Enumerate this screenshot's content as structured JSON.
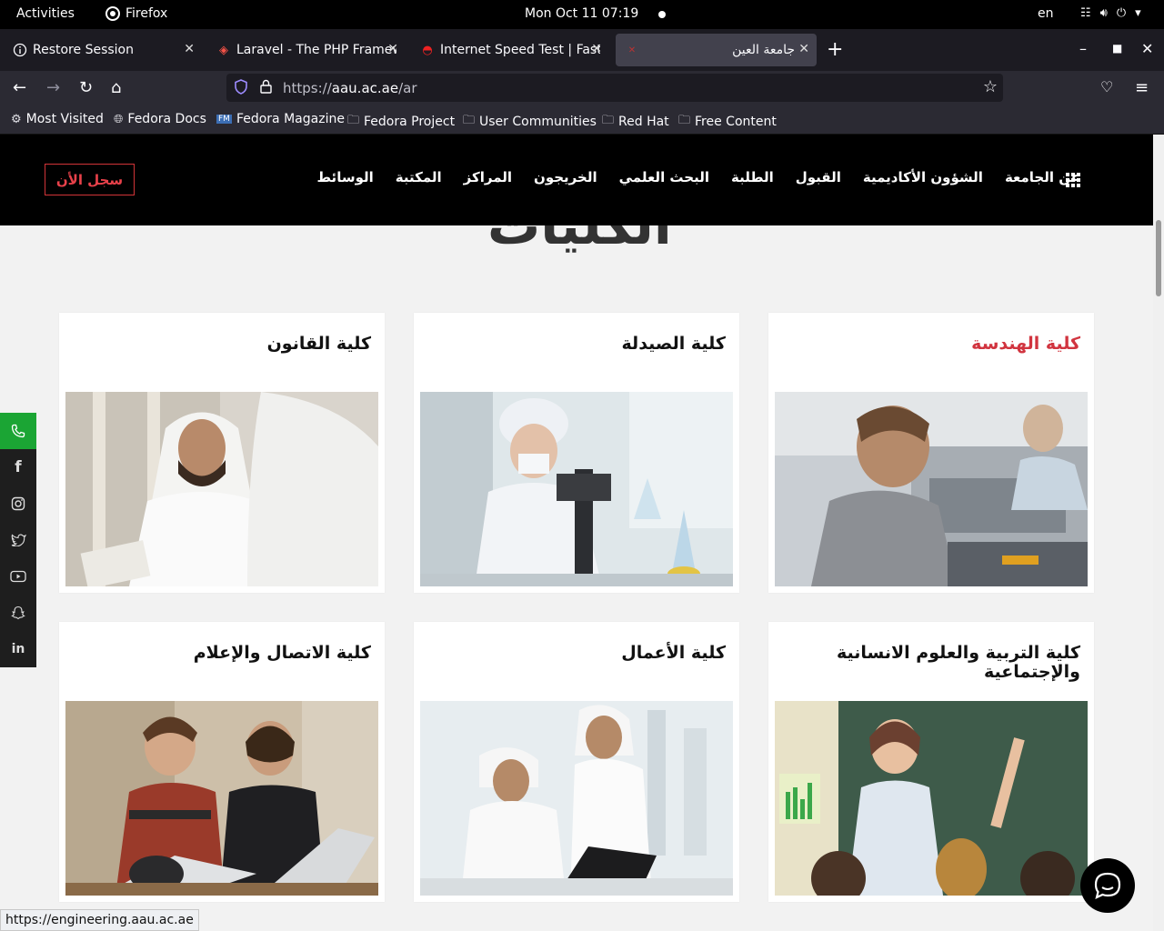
{
  "topbar": {
    "activities": "Activities",
    "app_name": "Firefox",
    "clock": "Mon Oct 11  07:19",
    "lang": "en"
  },
  "tabs": [
    {
      "label": "Restore Session",
      "icon": "info-icon"
    },
    {
      "label": "Laravel - The PHP Framew",
      "icon": "laravel-icon"
    },
    {
      "label": "Internet Speed Test | Fast",
      "icon": "speed-icon"
    },
    {
      "label": "جامعة العين",
      "icon": "aau-icon",
      "active": true
    }
  ],
  "navbar": {
    "url_prefix": "https://",
    "url_host": "aau.ac.ae",
    "url_path": "/ar"
  },
  "bookmarks": [
    {
      "label": "Most Visited",
      "icon": "gear-icon"
    },
    {
      "label": "Fedora Docs",
      "icon": "globe-icon"
    },
    {
      "label": "Fedora Magazine",
      "icon": "fm-icon"
    },
    {
      "label": "Fedora Project",
      "icon": "folder-icon"
    },
    {
      "label": "User Communities",
      "icon": "folder-icon"
    },
    {
      "label": "Red Hat",
      "icon": "folder-icon"
    },
    {
      "label": "Free Content",
      "icon": "folder-icon"
    }
  ],
  "site": {
    "apply_label": "سجل الأن",
    "menu": [
      "عن الجامعة",
      "الشؤون الأكاديمية",
      "القبول",
      "الطلبة",
      "البحث العلمي",
      "الخريجون",
      "المراكز",
      "المكتبة",
      "الوسائط"
    ],
    "section_heading": "الكليات",
    "accent_color": "#d1343f"
  },
  "colleges": [
    {
      "title": "كلية الهندسة",
      "highlight": true
    },
    {
      "title": "كلية الصيدلة"
    },
    {
      "title": "كلية القانون"
    },
    {
      "title": "كلية التربية والعلوم الانسانية والإجتماعية"
    },
    {
      "title": "كلية الأعمال"
    },
    {
      "title": "كلية الاتصال والإعلام"
    }
  ],
  "social": [
    "phone-icon",
    "facebook-icon",
    "instagram-icon",
    "twitter-icon",
    "youtube-icon",
    "snapchat-icon",
    "linkedin-icon"
  ],
  "status_url": "https://engineering.aau.ac.ae"
}
